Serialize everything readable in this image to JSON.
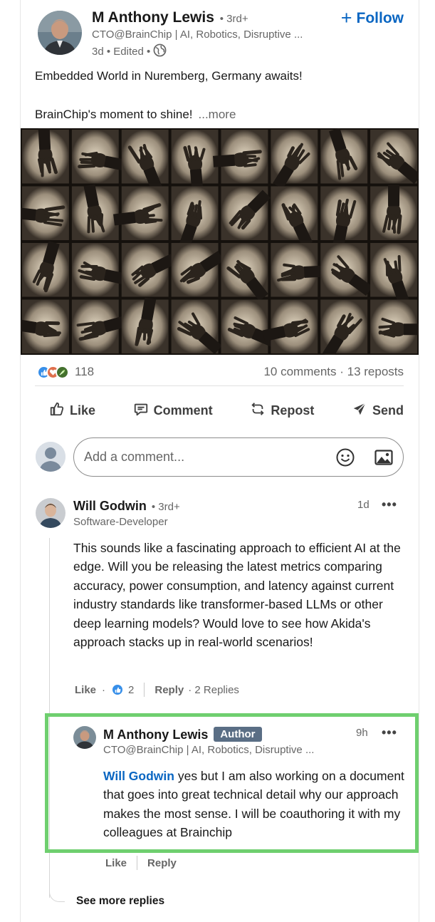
{
  "post": {
    "author": {
      "name": "M Anthony Lewis",
      "degree": "• 3rd+",
      "headline": "CTO@BrainChip | AI, Robotics, Disruptive ...",
      "meta": "3d • Edited •"
    },
    "follow_label": "Follow",
    "text_line1": "Embedded World in Nuremberg, Germany awaits!",
    "text_line2": "BrainChip's moment to shine!",
    "more_label": "...more"
  },
  "social": {
    "reaction_count": "118",
    "counts_text": "10 comments · 13 reposts"
  },
  "actions": {
    "like": "Like",
    "comment": "Comment",
    "repost": "Repost",
    "send": "Send"
  },
  "comment_box": {
    "placeholder": "Add a comment..."
  },
  "comments": [
    {
      "name": "Will Godwin",
      "degree": "• 3rd+",
      "headline": "Software-Developer",
      "time": "1d",
      "body": "This sounds like a fascinating approach to efficient AI at the edge. Will you be releasing the latest metrics comparing accuracy, power consumption, and latency against current industry standards like transformer-based LLMs or other deep learning models? Would love to see how Akida's approach stacks up in real-world scenarios!",
      "like_label": "Like",
      "sep": "·",
      "like_count": "2",
      "reply_label": "Reply",
      "replies_text": "· 2 Replies"
    }
  ],
  "reply": {
    "name": "M Anthony Lewis",
    "badge": "Author",
    "headline": "CTO@BrainChip | AI, Robotics, Disruptive ...",
    "time": "9h",
    "mention": "Will Godwin",
    "body": " yes but I am also working on a document that goes into great technical detail why our approach makes the most sense. I will be coauthoring it with my colleagues at Brainchip",
    "like_label": "Like",
    "reply_label": "Reply"
  },
  "see_more_replies": "See more replies",
  "dots": "•••",
  "colors": {
    "link_blue": "#0a66c2",
    "highlight_green": "#6fcf6f",
    "author_badge": "#5a6e85"
  }
}
